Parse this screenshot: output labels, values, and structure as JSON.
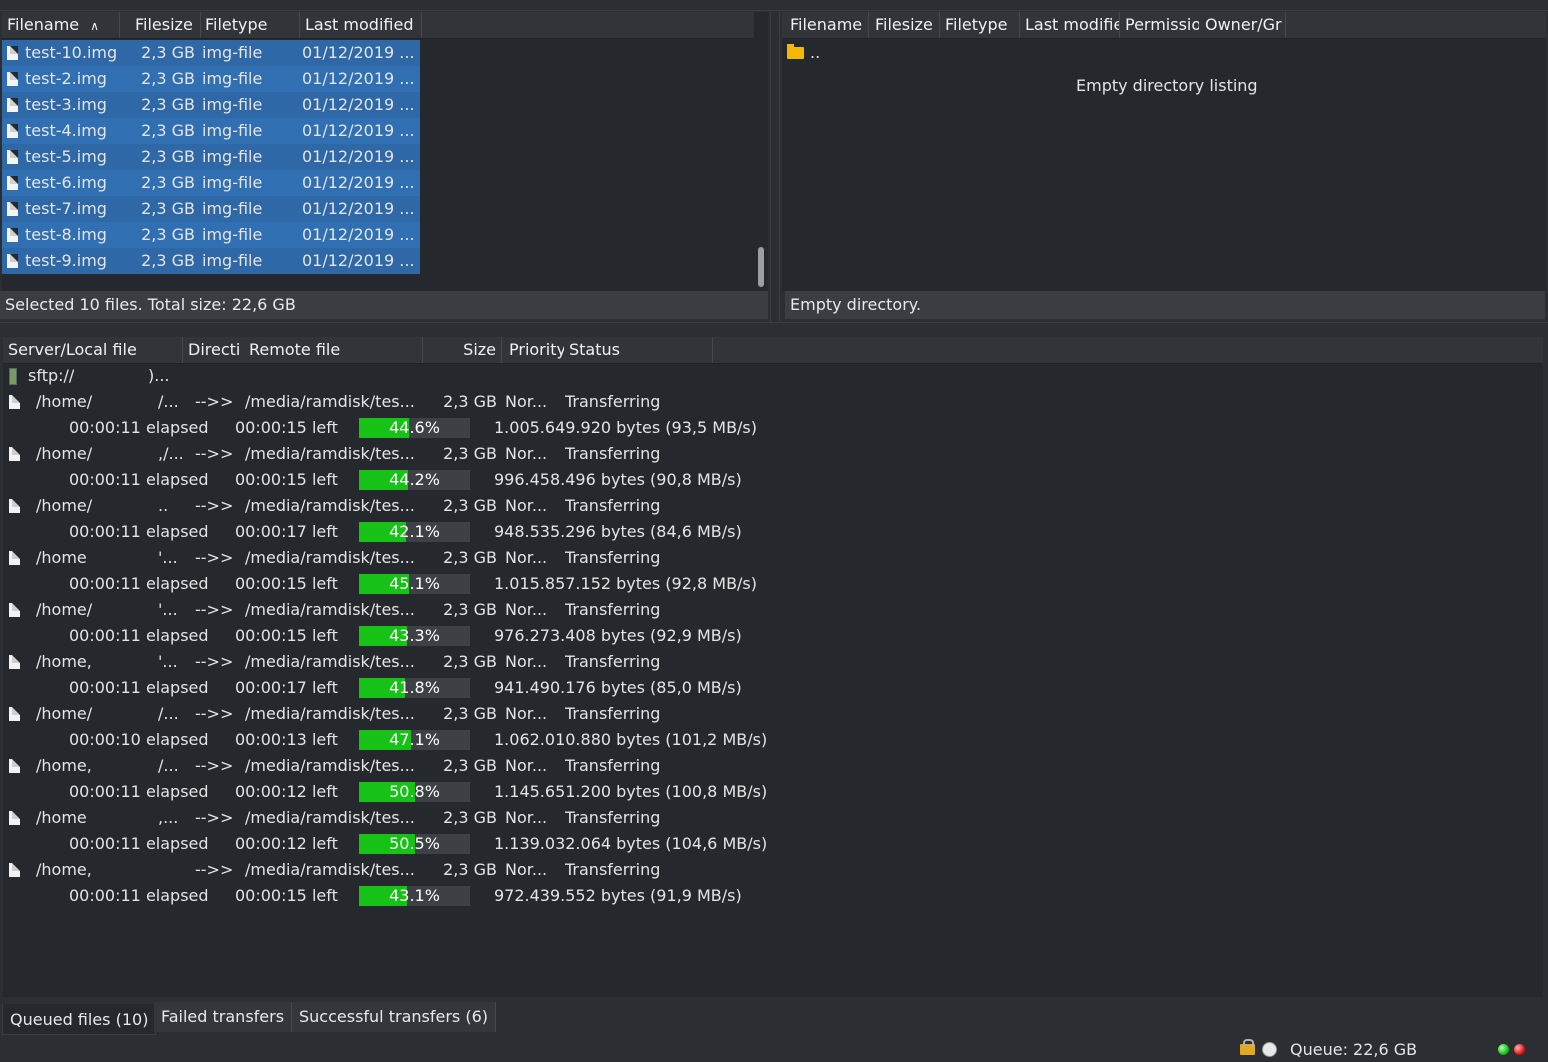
{
  "local_pane": {
    "headers": [
      "Filename",
      "Filesize",
      "Filetype",
      "Last modified"
    ],
    "files": [
      {
        "name": "test-10.img",
        "size": "2,3 GB",
        "type": "img-file",
        "modified": "01/12/2019 ..."
      },
      {
        "name": "test-2.img",
        "size": "2,3 GB",
        "type": "img-file",
        "modified": "01/12/2019 ..."
      },
      {
        "name": "test-3.img",
        "size": "2,3 GB",
        "type": "img-file",
        "modified": "01/12/2019 ..."
      },
      {
        "name": "test-4.img",
        "size": "2,3 GB",
        "type": "img-file",
        "modified": "01/12/2019 ..."
      },
      {
        "name": "test-5.img",
        "size": "2,3 GB",
        "type": "img-file",
        "modified": "01/12/2019 ..."
      },
      {
        "name": "test-6.img",
        "size": "2,3 GB",
        "type": "img-file",
        "modified": "01/12/2019 ..."
      },
      {
        "name": "test-7.img",
        "size": "2,3 GB",
        "type": "img-file",
        "modified": "01/12/2019 ..."
      },
      {
        "name": "test-8.img",
        "size": "2,3 GB",
        "type": "img-file",
        "modified": "01/12/2019 ..."
      },
      {
        "name": "test-9.img",
        "size": "2,3 GB",
        "type": "img-file",
        "modified": "01/12/2019 ..."
      }
    ],
    "status": "Selected 10 files. Total size: 22,6 GB"
  },
  "remote_pane": {
    "headers": [
      "Filename",
      "Filesize",
      "Filetype",
      "Last modifie",
      "Permissio",
      "Owner/Gr"
    ],
    "parent_dir": "..",
    "empty_message": "Empty directory listing",
    "status": "Empty directory."
  },
  "queue": {
    "headers": [
      "Server/Local file",
      "Directi",
      "Remote file",
      "Size",
      "Priority",
      "Status"
    ],
    "server": "sftp://",
    "server_suffix": ")...",
    "transfers": [
      {
        "local": "/home/",
        "local_tail": "/...",
        "direction": "-->>",
        "remote": "/media/ramdisk/tes...",
        "size": "2,3 GB",
        "priority": "Nor...",
        "status": "Transferring",
        "elapsed": "00:00:11 elapsed",
        "left": "00:00:15 left",
        "percent": 44.6,
        "percent_label": "44.6%",
        "bytes": "1.005.649.920 bytes (93,5 MB/s)"
      },
      {
        "local": "/home/",
        "local_tail": ",/...",
        "direction": "-->>",
        "remote": "/media/ramdisk/tes...",
        "size": "2,3 GB",
        "priority": "Nor...",
        "status": "Transferring",
        "elapsed": "00:00:11 elapsed",
        "left": "00:00:15 left",
        "percent": 44.2,
        "percent_label": "44.2%",
        "bytes": "996.458.496 bytes (90,8 MB/s)"
      },
      {
        "local": "/home/",
        "local_tail": "..",
        "direction": "-->>",
        "remote": "/media/ramdisk/tes...",
        "size": "2,3 GB",
        "priority": "Nor...",
        "status": "Transferring",
        "elapsed": "00:00:11 elapsed",
        "left": "00:00:17 left",
        "percent": 42.1,
        "percent_label": "42.1%",
        "bytes": "948.535.296 bytes (84,6 MB/s)"
      },
      {
        "local": "/home",
        "local_tail": "'...",
        "direction": "-->>",
        "remote": "/media/ramdisk/tes...",
        "size": "2,3 GB",
        "priority": "Nor...",
        "status": "Transferring",
        "elapsed": "00:00:11 elapsed",
        "left": "00:00:15 left",
        "percent": 45.1,
        "percent_label": "45.1%",
        "bytes": "1.015.857.152 bytes (92,8 MB/s)"
      },
      {
        "local": "/home/",
        "local_tail": "'...",
        "direction": "-->>",
        "remote": "/media/ramdisk/tes...",
        "size": "2,3 GB",
        "priority": "Nor...",
        "status": "Transferring",
        "elapsed": "00:00:11 elapsed",
        "left": "00:00:15 left",
        "percent": 43.3,
        "percent_label": "43.3%",
        "bytes": "976.273.408 bytes (92,9 MB/s)"
      },
      {
        "local": "/home,",
        "local_tail": "'...",
        "direction": "-->>",
        "remote": "/media/ramdisk/tes...",
        "size": "2,3 GB",
        "priority": "Nor...",
        "status": "Transferring",
        "elapsed": "00:00:11 elapsed",
        "left": "00:00:17 left",
        "percent": 41.8,
        "percent_label": "41.8%",
        "bytes": "941.490.176 bytes (85,0 MB/s)"
      },
      {
        "local": "/home/",
        "local_tail": "/...",
        "direction": "-->>",
        "remote": "/media/ramdisk/tes...",
        "size": "2,3 GB",
        "priority": "Nor...",
        "status": "Transferring",
        "elapsed": "00:00:10 elapsed",
        "left": "00:00:13 left",
        "percent": 47.1,
        "percent_label": "47.1%",
        "bytes": "1.062.010.880 bytes (101,2 MB/s)"
      },
      {
        "local": "/home,",
        "local_tail": "/...",
        "direction": "-->>",
        "remote": "/media/ramdisk/tes...",
        "size": "2,3 GB",
        "priority": "Nor...",
        "status": "Transferring",
        "elapsed": "00:00:11 elapsed",
        "left": "00:00:12 left",
        "percent": 50.8,
        "percent_label": "50.8%",
        "bytes": "1.145.651.200 bytes (100,8 MB/s)"
      },
      {
        "local": "/home",
        "local_tail": ",...",
        "direction": "-->>",
        "remote": "/media/ramdisk/tes...",
        "size": "2,3 GB",
        "priority": "Nor...",
        "status": "Transferring",
        "elapsed": "00:00:11 elapsed",
        "left": "00:00:12 left",
        "percent": 50.5,
        "percent_label": "50.5%",
        "bytes": "1.139.032.064 bytes (104,6 MB/s)"
      },
      {
        "local": "/home,",
        "local_tail": "",
        "direction": "-->>",
        "remote": "/media/ramdisk/tes...",
        "size": "2,3 GB",
        "priority": "Nor...",
        "status": "Transferring",
        "elapsed": "00:00:11 elapsed",
        "left": "00:00:15 left",
        "percent": 43.1,
        "percent_label": "43.1%",
        "bytes": "972.439.552 bytes (91,9 MB/s)"
      }
    ]
  },
  "tabs": [
    "Queued files (10)",
    "Failed transfers",
    "Successful transfers (6)"
  ],
  "statusbar": {
    "queue": "Queue: 22,6 GB",
    "icons": [
      "lock-icon",
      "speed-limit-icon",
      "green-led-icon",
      "red-led-icon"
    ]
  },
  "colors": {
    "selection": "#2f6aa8",
    "progress_fill": "#16c216",
    "folder": "#f5b800"
  }
}
